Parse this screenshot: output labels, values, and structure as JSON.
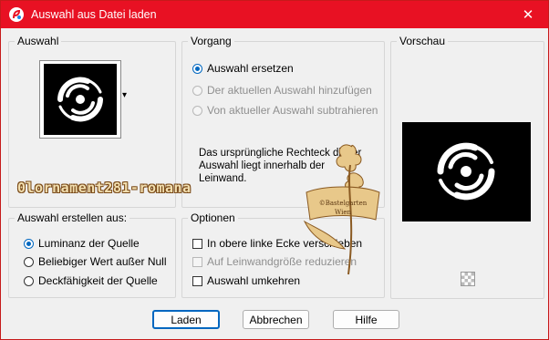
{
  "window": {
    "title": "Auswahl aus Datei laden",
    "close_glyph": "✕"
  },
  "auswahl": {
    "label": "Auswahl",
    "dropdown_glyph": "▾"
  },
  "vorgang": {
    "label": "Vorgang",
    "options": [
      {
        "label": "Auswahl ersetzen",
        "checked": true,
        "enabled": true
      },
      {
        "label": "Der aktuellen Auswahl hinzufügen",
        "checked": false,
        "enabled": false
      },
      {
        "label": "Von aktueller Auswahl subtrahieren",
        "checked": false,
        "enabled": false
      }
    ],
    "note": "Das ursprüngliche Rechteck dieser Auswahl liegt innerhalb der Leinwand."
  },
  "vorschau": {
    "label": "Vorschau"
  },
  "erstellen": {
    "label": "Auswahl erstellen aus:",
    "options": [
      {
        "label": "Luminanz der Quelle",
        "checked": true
      },
      {
        "label": "Beliebiger Wert außer Null",
        "checked": false
      },
      {
        "label": "Deckfähigkeit der Quelle",
        "checked": false
      }
    ]
  },
  "optionen": {
    "label": "Optionen",
    "items": [
      {
        "label": "In obere linke Ecke verschieben",
        "checked": false,
        "enabled": true
      },
      {
        "label": "Auf Leinwandgröße reduzieren",
        "checked": false,
        "enabled": false
      },
      {
        "label": "Auswahl umkehren",
        "checked": false,
        "enabled": true
      }
    ]
  },
  "buttons": {
    "load": "Laden",
    "cancel": "Abbrechen",
    "help": "Hilfe"
  },
  "watermark": {
    "text": "0lornament281-romana",
    "stamp_lines": [
      "©Bastelgarten",
      "Wien"
    ]
  },
  "colors": {
    "titlebar": "#e81123",
    "accent": "#0067c0",
    "watermark": "#c8914a"
  },
  "icons": {
    "app": "paintshop-icon",
    "close": "close-icon",
    "transparency": "checkerboard-icon"
  }
}
